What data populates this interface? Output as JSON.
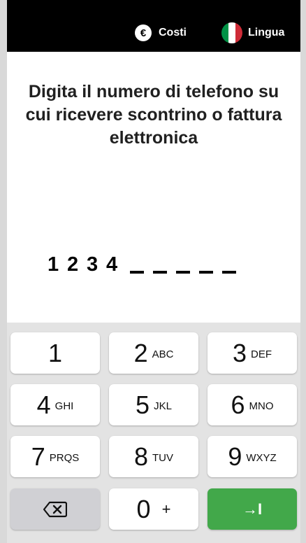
{
  "topbar": {
    "costs_label": "Costi",
    "costs_icon_text": "€",
    "language_label": "Lingua",
    "flag_colors": [
      "#009246",
      "#ffffff",
      "#ce2b37"
    ]
  },
  "prompt": "Digita il numero di telefono su cui ricevere scontrino o fattura elettronica",
  "entered_digits": [
    "1",
    "2",
    "3",
    "4"
  ],
  "remaining_slots": 5,
  "keypad": {
    "keys": [
      {
        "main": "1",
        "sub": ""
      },
      {
        "main": "2",
        "sub": "ABC"
      },
      {
        "main": "3",
        "sub": "DEF"
      },
      {
        "main": "4",
        "sub": "GHI"
      },
      {
        "main": "5",
        "sub": "JKL"
      },
      {
        "main": "6",
        "sub": "MNO"
      },
      {
        "main": "7",
        "sub": "PRQS"
      },
      {
        "main": "8",
        "sub": "TUV"
      },
      {
        "main": "9",
        "sub": "WXYZ"
      }
    ],
    "zero": {
      "main": "0",
      "sub": "+"
    },
    "backspace_icon": "backspace-icon",
    "confirm_label": "→I",
    "confirm_color": "#42a84a"
  }
}
